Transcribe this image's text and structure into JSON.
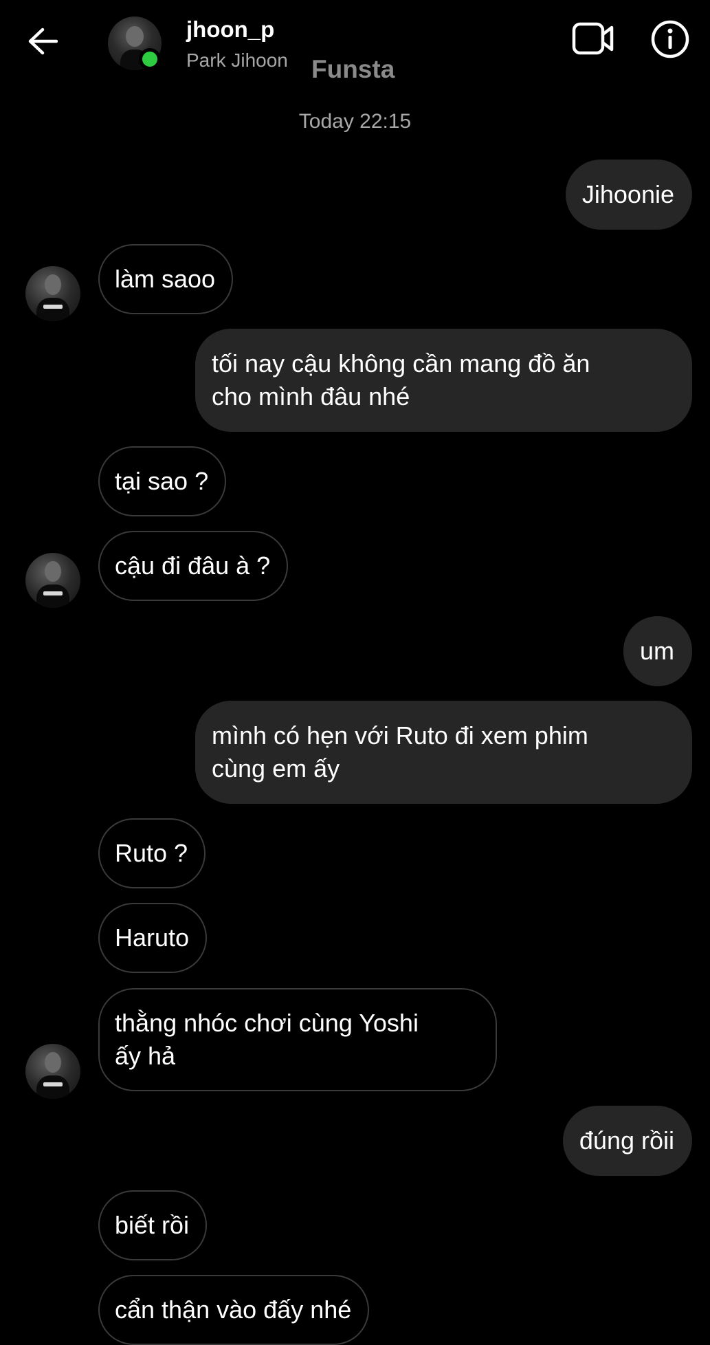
{
  "header": {
    "username": "jhoon_p",
    "fullname": "Park Jihoon",
    "watermark": "Funsta",
    "back_icon": "arrow-left-icon",
    "video_icon": "video-camera-icon",
    "info_icon": "info-icon",
    "online_color": "#2ecc40"
  },
  "thread": {
    "timestamp": "Today 22:15",
    "messages": [
      {
        "text": "Jihoonie",
        "from": "me"
      },
      {
        "text": "làm saoo",
        "from": "them"
      },
      {
        "text": "tối nay cậu không cần mang đồ ăn\ncho mình đâu nhé",
        "from": "me"
      },
      {
        "text": "tại sao ?",
        "from": "them"
      },
      {
        "text": "cậu đi đâu à ?",
        "from": "them"
      },
      {
        "text": "um",
        "from": "me"
      },
      {
        "text": "mình có hẹn với Ruto đi xem phim\ncùng em ấy",
        "from": "me"
      },
      {
        "text": "Ruto ?",
        "from": "them"
      },
      {
        "text": "Haruto",
        "from": "them"
      },
      {
        "text": "thằng nhóc chơi cùng Yoshi\nấy hả",
        "from": "them"
      },
      {
        "text": "đúng rồii",
        "from": "me"
      },
      {
        "text": "biết rồi",
        "from": "them"
      },
      {
        "text": "cẩn thận vào đấy nhé",
        "from": "them"
      }
    ]
  },
  "colors": {
    "background": "#000000",
    "sent_bubble": "#262626",
    "received_border": "#3a3a3a",
    "secondary_text": "#a8a8a8"
  }
}
